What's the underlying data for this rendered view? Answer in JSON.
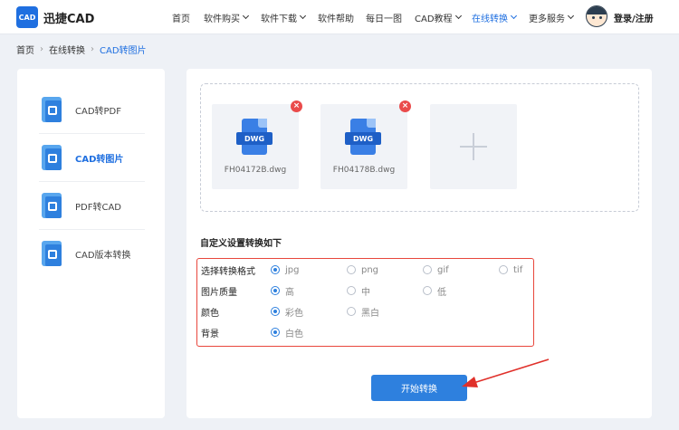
{
  "header": {
    "logo_text": "CAD",
    "brand": "迅捷CAD",
    "nav": [
      {
        "label": "首页",
        "dropdown": false
      },
      {
        "label": "软件购买",
        "dropdown": true
      },
      {
        "label": "软件下载",
        "dropdown": true
      },
      {
        "label": "软件帮助",
        "dropdown": false
      },
      {
        "label": "每日一图",
        "dropdown": false
      },
      {
        "label": "CAD教程",
        "dropdown": true
      },
      {
        "label": "在线转换",
        "dropdown": true,
        "active": true
      },
      {
        "label": "更多服务",
        "dropdown": true
      }
    ],
    "login": "登录/注册"
  },
  "breadcrumb": [
    "首页",
    "在线转换",
    "CAD转图片"
  ],
  "sidebar": {
    "items": [
      {
        "label": "CAD转PDF",
        "icon": "cad-to-pdf-icon",
        "active": false
      },
      {
        "label": "CAD转图片",
        "icon": "cad-to-image-icon",
        "active": true
      },
      {
        "label": "PDF转CAD",
        "icon": "pdf-to-cad-icon",
        "active": false
      },
      {
        "label": "CAD版本转换",
        "icon": "cad-version-icon",
        "active": false
      }
    ]
  },
  "upload": {
    "files": [
      {
        "name": "FH04172B.dwg",
        "type": "DWG"
      },
      {
        "name": "FH04178B.dwg",
        "type": "DWG"
      }
    ],
    "close_glyph": "×"
  },
  "settings": {
    "title": "自定义设置转换如下",
    "rows": [
      {
        "label": "选择转换格式",
        "options": [
          "jpg",
          "png",
          "gif",
          "tif"
        ],
        "selected": 0
      },
      {
        "label": "图片质量",
        "options": [
          "高",
          "中",
          "低"
        ],
        "selected": 0
      },
      {
        "label": "颜色",
        "options": [
          "彩色",
          "黑白"
        ],
        "selected": 0
      },
      {
        "label": "背景",
        "options": [
          "白色"
        ],
        "selected": 0
      }
    ]
  },
  "start_button": "开始转换",
  "colors": {
    "accent": "#2e80de",
    "highlight_border": "#e8463c",
    "close": "#ea4b4b"
  }
}
